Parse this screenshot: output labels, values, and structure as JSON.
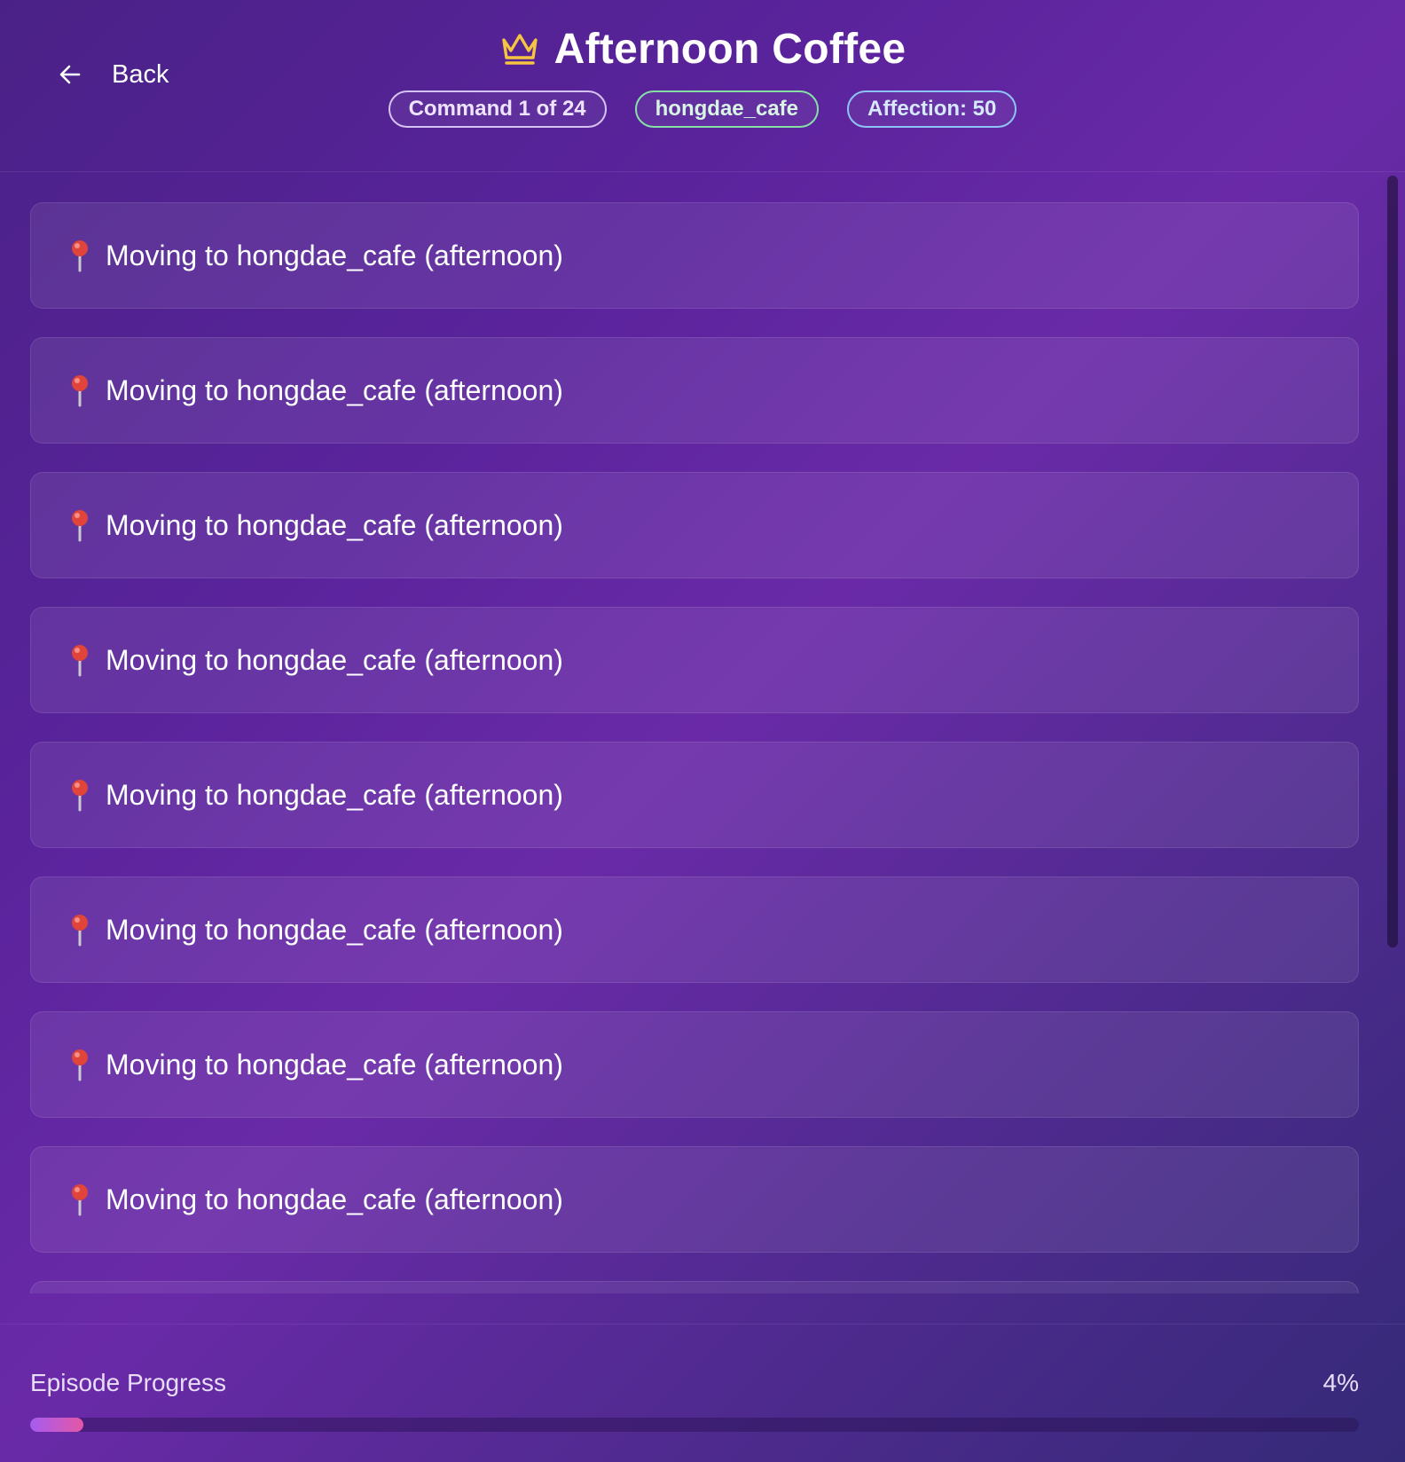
{
  "header": {
    "back_label": "Back",
    "title": "Afternoon Coffee",
    "badges": {
      "command": "Command 1 of 24",
      "location": "hongdae_cafe",
      "affection": "Affection: 50"
    }
  },
  "colors": {
    "crown": "#f5c542",
    "progress_start": "#a55cf0",
    "progress_end": "#e457a6"
  },
  "icons": {
    "back": "arrow-left-icon",
    "title": "crown-icon",
    "item": "pushpin-icon"
  },
  "commands": [
    {
      "text": "Moving to hongdae_cafe (afternoon)"
    },
    {
      "text": "Moving to hongdae_cafe (afternoon)"
    },
    {
      "text": "Moving to hongdae_cafe (afternoon)"
    },
    {
      "text": "Moving to hongdae_cafe (afternoon)"
    },
    {
      "text": "Moving to hongdae_cafe (afternoon)"
    },
    {
      "text": "Moving to hongdae_cafe (afternoon)"
    },
    {
      "text": "Moving to hongdae_cafe (afternoon)"
    },
    {
      "text": "Moving to hongdae_cafe (afternoon)"
    },
    {
      "text": ""
    }
  ],
  "footer": {
    "progress_label": "Episode Progress",
    "progress_text": "4%",
    "progress_value": 4
  }
}
